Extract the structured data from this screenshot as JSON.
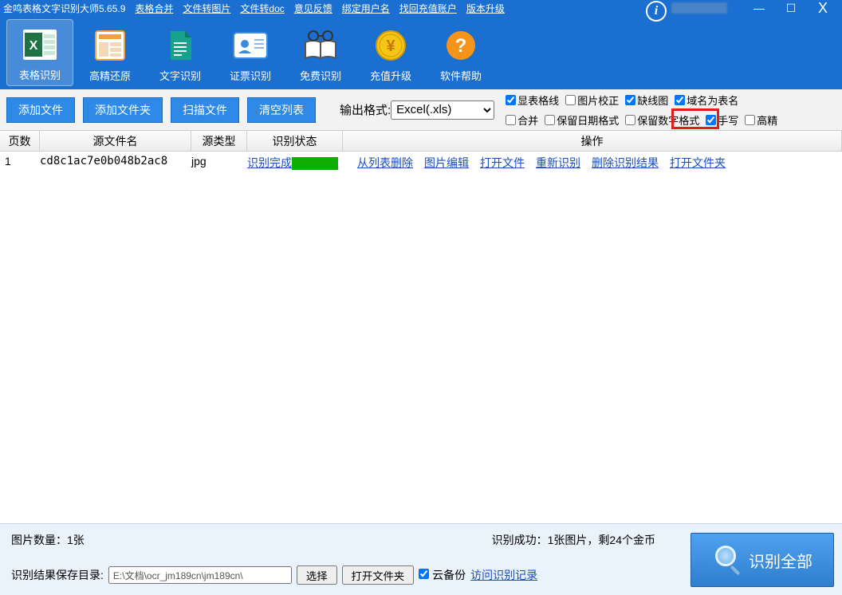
{
  "title": "金鸣表格文字识别大师5.65.9",
  "menu": {
    "merge": "表格合并",
    "toImage": "文件转图片",
    "toDoc": "文件转doc",
    "feedback": "意见反馈",
    "bindUser": "绑定用户名",
    "findAcct": "找回充值账户",
    "upgrade": "版本升级"
  },
  "tools": {
    "tableOcr": "表格识别",
    "hiFi": "高精还原",
    "textOcr": "文字识别",
    "idOcr": "证票识别",
    "freeOcr": "免费识别",
    "topup": "充值升级",
    "help": "软件帮助"
  },
  "btns": {
    "addFile": "添加文件",
    "addFolder": "添加文件夹",
    "scan": "扫描文件",
    "clear": "清空列表"
  },
  "output": {
    "label": "输出格式:",
    "value": "Excel(.xls)"
  },
  "chk": {
    "showGrid": "显表格线",
    "imgFix": "图片校正",
    "lackGrid": "缺线图",
    "domainAsName": "域名为表名",
    "merge": "合并",
    "keepDate": "保留日期格式",
    "keepNum": "保留数字格式",
    "handwrite": "手写",
    "hiPrec": "高精"
  },
  "th": {
    "page": "页数",
    "file": "源文件名",
    "type": "源类型",
    "status": "识别状态",
    "op": "操作"
  },
  "row": {
    "page": "1",
    "file": "cd8c1ac7e0b048b2ac8",
    "type": "jpg",
    "status": "识别完成",
    "op1": "从列表删除",
    "op2": "图片编辑",
    "op3": "打开文件",
    "op4": "重新识别",
    "op5": "删除识别结果",
    "op6": "打开文件夹"
  },
  "footer": {
    "count": "图片数量：1张",
    "success": "识别成功：1张图片，剩24个金币",
    "saveDirLabel": "识别结果保存目录:",
    "saveDir": "E:\\文档\\ocr_jm189cn\\jm189cn\\",
    "choose": "选择",
    "openFolder": "打开文件夹",
    "cloudBackup": "云备份",
    "visitLog": "访问识别记录",
    "runAll": "识别全部"
  }
}
